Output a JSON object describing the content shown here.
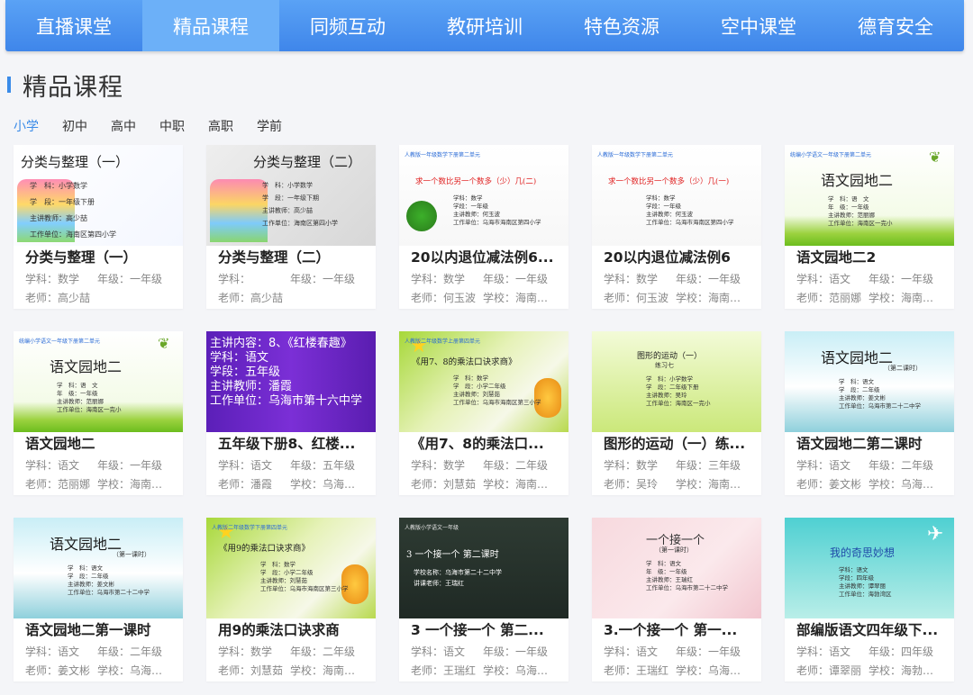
{
  "nav": {
    "items": [
      "直播课堂",
      "精品课程",
      "同频互动",
      "教研培训",
      "特色资源",
      "空中课堂",
      "德育安全"
    ],
    "active_index": 1
  },
  "section": {
    "title": "精品课程"
  },
  "levels": {
    "items": [
      "小学",
      "初中",
      "高中",
      "中职",
      "高职",
      "学前"
    ],
    "active_index": 0
  },
  "labels": {
    "subject": "学科：",
    "grade": "年级：",
    "teacher": "老师：",
    "school": "学校："
  },
  "colors": {
    "accent": "#3a8be8",
    "nav_bg": "#4a93ee"
  },
  "courses": [
    {
      "title": "分类与整理（一）",
      "subject": "数学",
      "grade": "一年级",
      "teacher": "高少喆",
      "school": "",
      "thumb": {
        "style": "cartoon-white",
        "heading": "分类与整理（一）",
        "lines": [
          "学　科：小学数学",
          "学　段：一年级下册",
          "主讲教师：高少喆",
          "工作单位：海南区第四小学"
        ]
      }
    },
    {
      "title": "分类与整理（二）",
      "subject": "",
      "grade": "一年级",
      "teacher": "高少喆",
      "school": "",
      "thumb": {
        "style": "cartoon-gray",
        "heading": "分类与整理（二）",
        "lines": [
          "学　科：小学数学",
          "学　段：一年级下期",
          "主讲教师：高少喆",
          "工作单位：海南区第四小学"
        ]
      }
    },
    {
      "title": "20以内退位减法例6...",
      "subject": "数学",
      "grade": "一年级",
      "teacher": "何玉波",
      "school": "海南区...",
      "thumb": {
        "style": "plant-white",
        "top": "人教版一年级数学下册第二单元",
        "heading": "求一个数比另一个数多（少）几(二)",
        "lines": [
          "学科：数学",
          "学段：一年级",
          "主讲教师：何玉波",
          "工作单位：乌海市海南区第四小学"
        ]
      }
    },
    {
      "title": "20以内退位减法例6",
      "subject": "数学",
      "grade": "一年级",
      "teacher": "何玉波",
      "school": "海南区...",
      "thumb": {
        "style": "plain-white",
        "top": "人教版一年级数学下册第二单元",
        "heading": "求一个数比另一个数多（少）几(一)",
        "lines": [
          "学科：数学",
          "学段：一年级",
          "主讲教师：何玉波",
          "工作单位：乌海市海南区第四小学"
        ]
      }
    },
    {
      "title": "语文园地二2",
      "subject": "语文",
      "grade": "一年级",
      "teacher": "范丽娜",
      "school": "海南区...",
      "thumb": {
        "style": "willow-green",
        "top": "统编小学语文一年级下册第二单元",
        "heading": "语文园地二",
        "lines": [
          "学　科：语　文",
          "年　级：一年级",
          "主讲教师：范丽娜",
          "工作单位：海南区一完小"
        ]
      }
    },
    {
      "title": "语文园地二",
      "subject": "语文",
      "grade": "一年级",
      "teacher": "范丽娜",
      "school": "海南区...",
      "thumb": {
        "style": "willow-green",
        "top": "统编小学语文一年级下册第二单元",
        "heading": "语文园地二",
        "lines": [
          "学　科：语　文",
          "年　级：一年级",
          "主讲教师：范丽娜",
          "工作单位：海南区一完小"
        ]
      }
    },
    {
      "title": "五年级下册8、红楼...",
      "subject": "语文",
      "grade": "五年级",
      "teacher": "潘霞",
      "school": "乌海市...",
      "thumb": {
        "style": "purple",
        "heading": "",
        "lines": [
          "主讲内容：8、《红楼春趣》",
          "学科：语文",
          "学段：五年级",
          "主讲教师：潘霞",
          "工作单位：乌海市第十六中学"
        ]
      }
    },
    {
      "title": "《用7、8的乘法口...",
      "subject": "数学",
      "grade": "二年级",
      "teacher": "刘慧茹",
      "school": "海南区...",
      "thumb": {
        "style": "lime-star",
        "top": "人教版二年级数学上册第四单元",
        "heading": "《用7、8的乘法口诀求商》",
        "lines": [
          "学　科：数学",
          "学　段：小学二年级",
          "主讲教师：刘慧茹",
          "工作单位：乌海市海南区第三小学"
        ]
      }
    },
    {
      "title": "图形的运动（一）练...",
      "subject": "数学",
      "grade": "三年级",
      "teacher": "吴玲",
      "school": "海南区...",
      "thumb": {
        "style": "lime-plain",
        "heading": "图形的运动（一）",
        "sub": "练习七",
        "lines": [
          "学　科：小学数学",
          "学　段：二年级下册",
          "主讲教师：吴玲",
          "工作单位：海南区一完小"
        ]
      }
    },
    {
      "title": "语文园地二第二课时",
      "subject": "语文",
      "grade": "二年级",
      "teacher": "姜文彬",
      "school": "乌海市...",
      "thumb": {
        "style": "cyan-grad",
        "heading": "语文园地二",
        "sub": "（第二课时）",
        "lines": [
          "学　科：语文",
          "学　段：二年级",
          "主讲教师：姜文彬",
          "工作单位：乌海市第二十二中学"
        ]
      }
    },
    {
      "title": "语文园地二第一课时",
      "subject": "语文",
      "grade": "二年级",
      "teacher": "姜文彬",
      "school": "乌海市...",
      "thumb": {
        "style": "cyan-grad",
        "heading": "语文园地二",
        "sub": "（第一课时）",
        "lines": [
          "学　科：语文",
          "学　段：二年级",
          "主讲教师：姜文彬",
          "工作单位：乌海市第二十二中学"
        ]
      }
    },
    {
      "title": "用9的乘法口诀求商",
      "subject": "数学",
      "grade": "二年级",
      "teacher": "刘慧茹",
      "school": "海南区...",
      "thumb": {
        "style": "lime-star",
        "top": "人教版二年级数学下册第四单元",
        "heading": "《用9的乘法口诀求商》",
        "lines": [
          "学　科：数学",
          "学　段：小学二年级",
          "主讲教师：刘慧茹",
          "工作单位：乌海市海南区第三小学"
        ]
      }
    },
    {
      "title": "3 一个接一个 第二...",
      "subject": "语文",
      "grade": "一年级",
      "teacher": "王瑞红",
      "school": "乌海市...",
      "thumb": {
        "style": "chalkboard",
        "top": "人教版小学语文一年级",
        "heading": "3 一个接一个 第二课时",
        "lines": [
          "学校名称：乌海市第二十二中学",
          "讲课老师：王瑞红"
        ]
      }
    },
    {
      "title": "3.一个接一个 第一...",
      "subject": "语文",
      "grade": "一年级",
      "teacher": "王瑞红",
      "school": "乌海市...",
      "thumb": {
        "style": "pink",
        "heading": "一个接一个",
        "sub": "（第一课时）",
        "lines": [
          "学　科：语文",
          "年　级：一年级",
          "主讲教师：王瑞红",
          "工作单位：乌海市第二十二中学"
        ]
      }
    },
    {
      "title": "部编版语文四年级下...",
      "subject": "语文",
      "grade": "四年级",
      "teacher": "谭翠丽",
      "school": "海勃湾...",
      "thumb": {
        "style": "teal-plane",
        "heading": "我的奇思妙想",
        "lines": [
          "学科：语文",
          "学段：四年级",
          "主讲教师：谭翠丽",
          "工作单位：海勃湾区"
        ]
      }
    }
  ]
}
